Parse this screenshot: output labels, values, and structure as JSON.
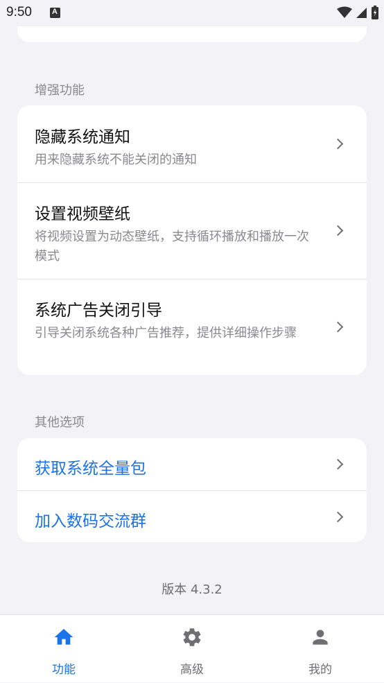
{
  "status_bar": {
    "time": "9:50"
  },
  "sections": {
    "enhanced": {
      "title": "增强功能",
      "items": [
        {
          "title": "隐藏系统通知",
          "desc": "用来隐藏系统不能关闭的通知"
        },
        {
          "title": "设置视频壁纸",
          "desc": "将视频设置为动态壁纸，支持循环播放和播放一次模式"
        },
        {
          "title": "系统广告关闭引导",
          "desc": "引导关闭系统各种广告推荐，提供详细操作步骤"
        }
      ]
    },
    "other": {
      "title": "其他选项",
      "items": [
        {
          "title": "获取系统全量包"
        },
        {
          "title": "加入数码交流群"
        }
      ]
    }
  },
  "version": "版本 4.3.2",
  "bottom_nav": {
    "items": [
      {
        "label": "功能",
        "icon": "home-icon",
        "active": true
      },
      {
        "label": "高级",
        "icon": "gear-icon",
        "active": false
      },
      {
        "label": "我的",
        "icon": "person-icon",
        "active": false
      }
    ]
  },
  "colors": {
    "accent": "#1a73e8",
    "inactive": "#6e6e73",
    "background": "#f2f2f7"
  }
}
